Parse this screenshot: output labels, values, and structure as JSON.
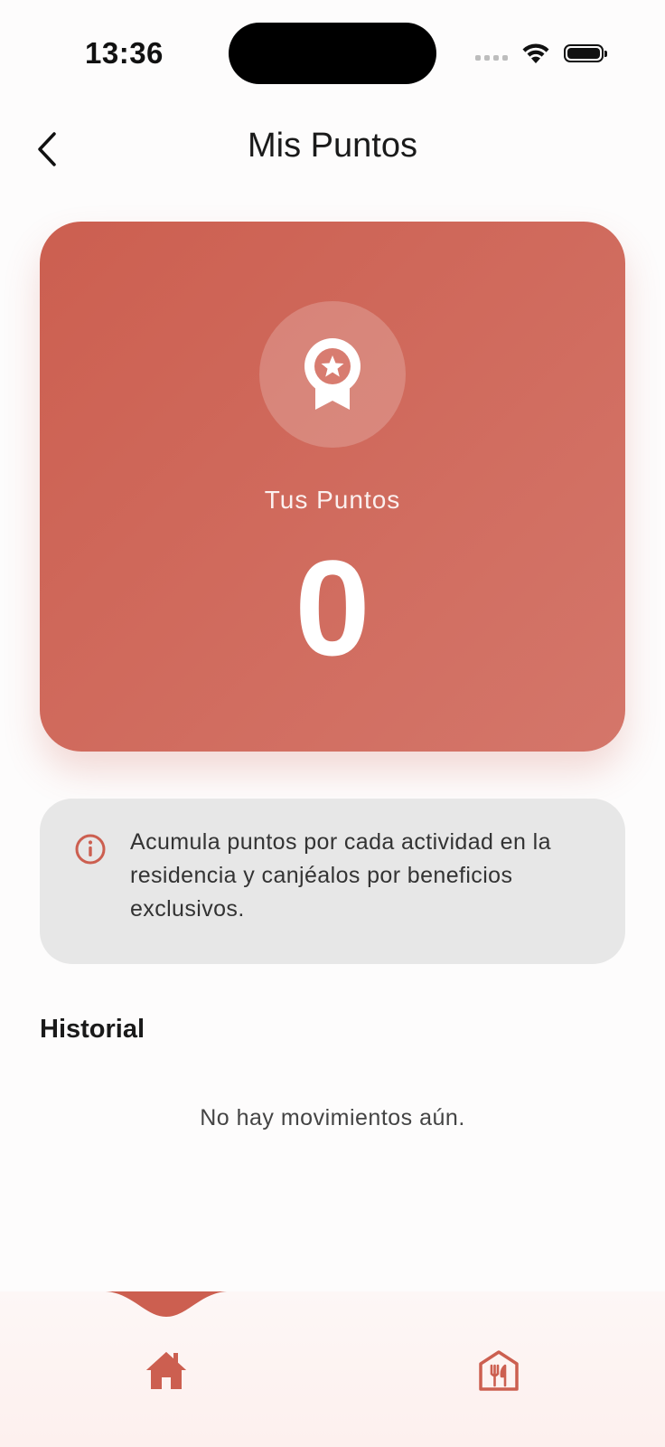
{
  "status_bar": {
    "time": "13:36",
    "icons": [
      "signal-dots-icon",
      "wifi-icon",
      "battery-icon"
    ]
  },
  "header": {
    "title": "Mis Puntos",
    "back_icon": "chevron-left-icon"
  },
  "points_card": {
    "icon": "award-badge-icon",
    "label": "Tus Puntos",
    "value": "0",
    "colors": {
      "gradient_start": "#cc5f50",
      "gradient_end": "#d4766a"
    }
  },
  "info": {
    "icon": "info-circle-icon",
    "text": "Acumula puntos por cada actividad en la residencia y canjéalos por beneficios exclusivos."
  },
  "history": {
    "title": "Historial",
    "empty_message": "No hay movimientos aún."
  },
  "bottom_nav": {
    "items": [
      {
        "icon": "home-icon",
        "active": true
      },
      {
        "icon": "restaurant-icon",
        "active": false
      }
    ]
  },
  "colors": {
    "accent": "#cc5f50",
    "background": "#fdfcfc",
    "info_box": "#e7e7e7"
  }
}
